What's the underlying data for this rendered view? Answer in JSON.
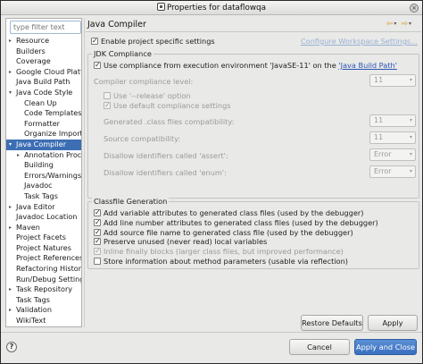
{
  "window": {
    "title": "Properties for dataflowqa",
    "close_glyph": "×"
  },
  "filter": {
    "placeholder": "type filter text"
  },
  "tree": [
    {
      "label": "Resource",
      "expander": "▸",
      "level": 0
    },
    {
      "label": "Builders",
      "expander": "",
      "level": 0
    },
    {
      "label": "Coverage",
      "expander": "",
      "level": 0
    },
    {
      "label": "Google Cloud Platform",
      "expander": "▸",
      "level": 0
    },
    {
      "label": "Java Build Path",
      "expander": "",
      "level": 0
    },
    {
      "label": "Java Code Style",
      "expander": "▾",
      "level": 0
    },
    {
      "label": "Clean Up",
      "expander": "",
      "level": 1
    },
    {
      "label": "Code Templates",
      "expander": "",
      "level": 1
    },
    {
      "label": "Formatter",
      "expander": "",
      "level": 1
    },
    {
      "label": "Organize Imports",
      "expander": "",
      "level": 1
    },
    {
      "label": "Java Compiler",
      "expander": "▾",
      "level": 0,
      "selected": true
    },
    {
      "label": "Annotation Processing",
      "expander": "▸",
      "level": 1
    },
    {
      "label": "Building",
      "expander": "",
      "level": 1
    },
    {
      "label": "Errors/Warnings",
      "expander": "",
      "level": 1
    },
    {
      "label": "Javadoc",
      "expander": "",
      "level": 1
    },
    {
      "label": "Task Tags",
      "expander": "",
      "level": 1
    },
    {
      "label": "Java Editor",
      "expander": "▸",
      "level": 0
    },
    {
      "label": "Javadoc Location",
      "expander": "",
      "level": 0
    },
    {
      "label": "Maven",
      "expander": "▸",
      "level": 0
    },
    {
      "label": "Project Facets",
      "expander": "",
      "level": 0
    },
    {
      "label": "Project Natures",
      "expander": "",
      "level": 0
    },
    {
      "label": "Project References",
      "expander": "",
      "level": 0
    },
    {
      "label": "Refactoring History",
      "expander": "",
      "level": 0
    },
    {
      "label": "Run/Debug Settings",
      "expander": "",
      "level": 0
    },
    {
      "label": "Task Repository",
      "expander": "▸",
      "level": 0
    },
    {
      "label": "Task Tags",
      "expander": "",
      "level": 0
    },
    {
      "label": "Validation",
      "expander": "▸",
      "level": 0
    },
    {
      "label": "WikiText",
      "expander": "",
      "level": 0
    }
  ],
  "page": {
    "title": "Java Compiler",
    "nav_back": "⇦",
    "nav_forward": "⇨",
    "nav_dropdown": "▾",
    "enable_specific": {
      "label": "Enable project specific settings",
      "checked": true
    },
    "configure_link": "Configure Workspace Settings..."
  },
  "jdk": {
    "group_title": "JDK Compliance",
    "use_env": {
      "label_prefix": "Use compliance from execution environment 'JavaSE-11' on the ",
      "link": "'Java Build Path'",
      "checked": true
    },
    "compliance_level": {
      "label": "Compiler compliance level:",
      "value": "11"
    },
    "use_release": {
      "label": "Use '--release' option",
      "checked": false
    },
    "use_default": {
      "label": "Use default compliance settings",
      "checked": true
    },
    "generated_class": {
      "label": "Generated .class files compatibility:",
      "value": "11"
    },
    "source_compat": {
      "label": "Source compatibility:",
      "value": "11"
    },
    "disallow_assert": {
      "label": "Disallow identifiers called 'assert':",
      "value": "Error"
    },
    "disallow_enum": {
      "label": "Disallow identifiers called 'enum':",
      "value": "Error"
    },
    "combo_arrow": "▾"
  },
  "classfile": {
    "group_title": "Classfile Generation",
    "options": [
      {
        "label": "Add variable attributes to generated class files (used by the debugger)",
        "checked": true,
        "disabled": false
      },
      {
        "label": "Add line number attributes to generated class files (used by the debugger)",
        "checked": true,
        "disabled": false
      },
      {
        "label": "Add source file name to generated class file (used by the debugger)",
        "checked": true,
        "disabled": false
      },
      {
        "label": "Preserve unused (never read) local variables",
        "checked": true,
        "disabled": false
      },
      {
        "label": "Inline finally blocks (larger class files, but improved performance)",
        "checked": true,
        "disabled": true
      },
      {
        "label": "Store information about method parameters (usable via reflection)",
        "checked": false,
        "disabled": false
      }
    ]
  },
  "buttons": {
    "restore_defaults": "Restore Defaults",
    "apply": "Apply",
    "cancel": "Cancel",
    "apply_and_close": "Apply and Close",
    "help": "?"
  }
}
